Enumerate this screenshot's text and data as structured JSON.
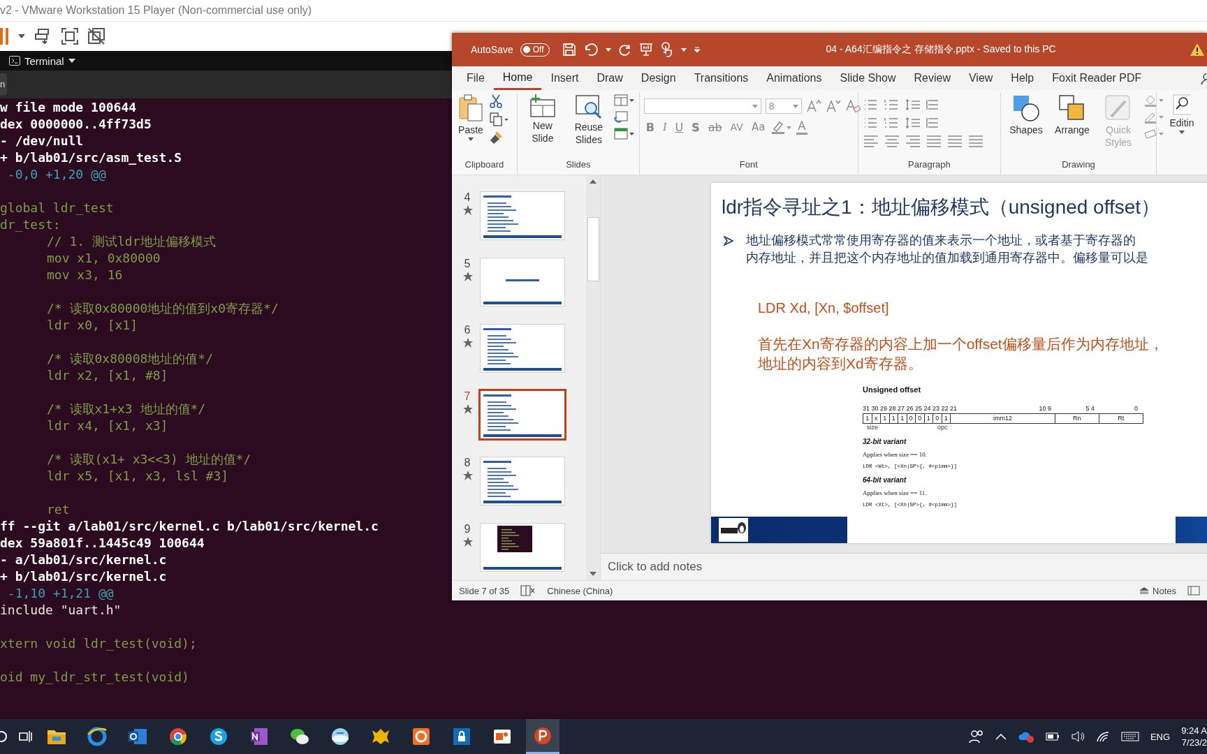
{
  "vmware": {
    "title": "v2 - VMware Workstation 15 Player (Non-commercial use only)",
    "terminal_menu": "Terminal",
    "tab_label": "n"
  },
  "terminal": {
    "lines": [
      {
        "kind": "header",
        "indent": false,
        "text": "w file mode 100644"
      },
      {
        "kind": "header",
        "indent": false,
        "text": "dex 0000000..4ff73d5"
      },
      {
        "kind": "header",
        "indent": false,
        "text": "- /dev/null"
      },
      {
        "kind": "header",
        "indent": false,
        "text": "+ b/lab01/src/asm_test.S"
      },
      {
        "kind": "hunk",
        "indent": false,
        "text": " -0,0 +1,20 @@"
      },
      {
        "kind": "blank"
      },
      {
        "kind": "added",
        "indent": false,
        "text": "global ldr_test"
      },
      {
        "kind": "added",
        "indent": false,
        "text": "dr_test:"
      },
      {
        "kind": "added",
        "indent": true,
        "text": "// 1. 测试ldr地址偏移模式"
      },
      {
        "kind": "added",
        "indent": true,
        "text": "mov x1, 0x80000"
      },
      {
        "kind": "added",
        "indent": true,
        "text": "mov x3, 16"
      },
      {
        "kind": "blank"
      },
      {
        "kind": "added",
        "indent": true,
        "text": "/* 读取0x80000地址的值到x0寄存器*/"
      },
      {
        "kind": "added",
        "indent": true,
        "text": "ldr x0, [x1]"
      },
      {
        "kind": "blank"
      },
      {
        "kind": "added",
        "indent": true,
        "text": "/* 读取0x80008地址的值*/"
      },
      {
        "kind": "added",
        "indent": true,
        "text": "ldr x2, [x1, #8]"
      },
      {
        "kind": "blank"
      },
      {
        "kind": "added",
        "indent": true,
        "text": "/* 读取x1+x3 地址的值*/"
      },
      {
        "kind": "added",
        "indent": true,
        "text": "ldr x4, [x1, x3]"
      },
      {
        "kind": "blank"
      },
      {
        "kind": "added",
        "indent": true,
        "text": "/* 读取(x1+ x3<<3) 地址的值*/"
      },
      {
        "kind": "added",
        "indent": true,
        "text": "ldr x5, [x1, x3, lsl #3]"
      },
      {
        "kind": "blank"
      },
      {
        "kind": "added",
        "indent": true,
        "text": "ret"
      },
      {
        "kind": "header",
        "indent": false,
        "text": "ff --git a/lab01/src/kernel.c b/lab01/src/kernel.c"
      },
      {
        "kind": "header",
        "indent": false,
        "text": "dex 59a801f..1445c49 100644"
      },
      {
        "kind": "header",
        "indent": false,
        "text": "- a/lab01/src/kernel.c"
      },
      {
        "kind": "header",
        "indent": false,
        "text": "+ b/lab01/src/kernel.c"
      },
      {
        "kind": "hunk",
        "indent": false,
        "text": " -1,10 +1,21 @@"
      },
      {
        "kind": "context",
        "indent": false,
        "text": "include \"uart.h\""
      },
      {
        "kind": "blank"
      },
      {
        "kind": "added",
        "indent": false,
        "text": "xtern void ldr_test(void);"
      },
      {
        "kind": "blank"
      },
      {
        "kind": "added",
        "indent": false,
        "text": "oid my_ldr_str_test(void)"
      }
    ]
  },
  "powerpoint": {
    "autosave": {
      "label": "AutoSave",
      "toggle": "Off",
      "on": false
    },
    "title": "04 - A64汇编指令之 存储指令.pptx  -  Saved to this PC",
    "tabs": [
      {
        "label": "File",
        "selected": false
      },
      {
        "label": "Home",
        "selected": true
      },
      {
        "label": "Insert",
        "selected": false
      },
      {
        "label": "Draw",
        "selected": false
      },
      {
        "label": "Design",
        "selected": false
      },
      {
        "label": "Transitions",
        "selected": false
      },
      {
        "label": "Animations",
        "selected": false
      },
      {
        "label": "Slide Show",
        "selected": false
      },
      {
        "label": "Review",
        "selected": false
      },
      {
        "label": "View",
        "selected": false
      },
      {
        "label": "Help",
        "selected": false
      },
      {
        "label": "Foxit Reader PDF",
        "selected": false
      }
    ],
    "ribbon": {
      "clipboard": {
        "label": "Clipboard",
        "paste": "Paste"
      },
      "slides": {
        "label": "Slides",
        "buttons": [
          {
            "label": "New Slide",
            "disabled": false
          },
          {
            "label": "Reuse Slides",
            "disabled": false
          }
        ]
      },
      "font": {
        "label": "Font",
        "size": "8",
        "format_buttons": [
          "B",
          "I",
          "U",
          "S",
          "ab",
          "AV",
          "Aa"
        ],
        "font_color": "A"
      },
      "paragraph": {
        "label": "Paragraph"
      },
      "drawing": {
        "label": "Drawing",
        "buttons": [
          {
            "label": "Shapes",
            "disabled": false
          },
          {
            "label": "Arrange",
            "disabled": false
          },
          {
            "label": "Quick Styles",
            "disabled": true
          }
        ]
      },
      "editing": {
        "label": "Editin"
      }
    },
    "thumbnails": [
      {
        "number": "4",
        "kind": "text",
        "selected": false
      },
      {
        "number": "5",
        "kind": "title",
        "selected": false
      },
      {
        "number": "6",
        "kind": "text",
        "selected": false
      },
      {
        "number": "7",
        "kind": "text",
        "selected": true
      },
      {
        "number": "8",
        "kind": "text",
        "selected": false
      },
      {
        "number": "9",
        "kind": "image",
        "selected": false
      }
    ],
    "slide": {
      "title": "ldr指令寻址之1：地址偏移模式（unsigned offset）",
      "bullet_lines": [
        "地址偏移模式常常使用寄存器的值来表示一个地址，或者基于寄存器的",
        "内存地址，并且把这个内存地址的值加载到通用寄存器中。偏移量可以是"
      ],
      "syntax": "LDR Xd, [Xn, $offset]",
      "description_lines": [
        "首先在Xn寄存器的内容上加一个offset偏移量后作为内存地址，",
        "地址的内容到Xd寄存器。"
      ],
      "figure": {
        "heading": "Unsigned offset",
        "bit_labels": [
          "31 30 29 28 27 26 25 24 23 22 21",
          "10 9",
          "5 4",
          "0"
        ],
        "fields": [
          {
            "kind": "bit",
            "label": "1"
          },
          {
            "kind": "bit",
            "label": "x"
          },
          {
            "kind": "bit",
            "label": "1"
          },
          {
            "kind": "bit",
            "label": "1"
          },
          {
            "kind": "bit",
            "label": "1"
          },
          {
            "kind": "bit",
            "label": "0"
          },
          {
            "kind": "bit",
            "label": "0"
          },
          {
            "kind": "bit",
            "label": "1"
          },
          {
            "kind": "bit",
            "label": "0"
          },
          {
            "kind": "bit",
            "label": "1"
          },
          {
            "kind": "field",
            "label": "imm12"
          },
          {
            "kind": "field",
            "label": "Rn"
          },
          {
            "kind": "field",
            "label": "Rt"
          }
        ],
        "field_names": [
          "size",
          "opc"
        ],
        "variants": [
          {
            "title": "32-bit variant",
            "condition": "Applies when size == 10.",
            "syntax": "LDR <Wt>, [<Xn|SP>{, #<pimm>}]"
          },
          {
            "title": "64-bit variant",
            "condition": "Applies when size == 11.",
            "syntax": "LDR <Xt>, [<Xn|SP>{, #<pimm>}]"
          }
        ]
      }
    },
    "notes": {
      "placeholder": "Click to add notes"
    },
    "status_bar": {
      "slide": "Slide 7 of 35",
      "language": "Chinese (China)",
      "notes": "Notes"
    }
  },
  "taskbar": {
    "apps": [
      {
        "selected": false
      },
      {
        "selected": false
      },
      {
        "selected": false
      },
      {
        "selected": false
      },
      {
        "selected": false
      },
      {
        "selected": false
      },
      {
        "selected": false
      },
      {
        "selected": false
      },
      {
        "selected": false
      },
      {
        "selected": false
      },
      {
        "selected": false
      },
      {
        "selected": false
      },
      {
        "selected": true
      }
    ],
    "language": "ENG",
    "time": "9:24 A",
    "date": "7/23/2"
  }
}
